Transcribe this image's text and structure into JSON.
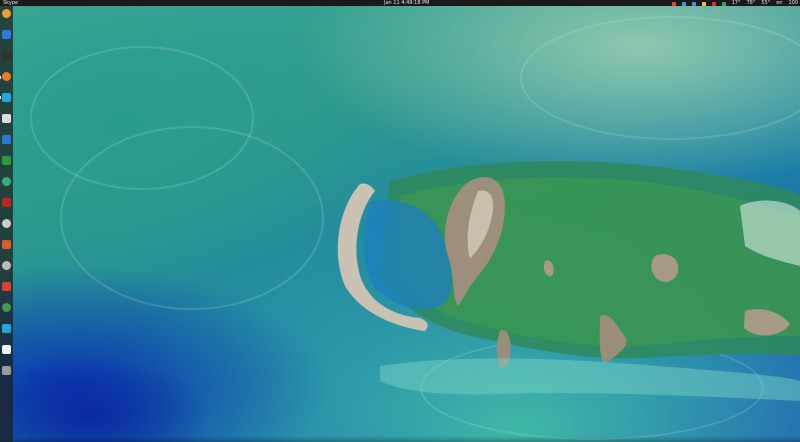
{
  "top_panel": {
    "app_name": "Skype",
    "clock": "Jan 11  4:49:18 PM",
    "tray": [
      {
        "name": "chrome-tray-icon",
        "color": "#e44d3a"
      },
      {
        "name": "skype-tray-icon",
        "color": "#2aa9e0"
      },
      {
        "name": "dropbox-tray-icon",
        "color": "#4a90e2"
      },
      {
        "name": "note-tray-icon",
        "color": "#f3c13a"
      },
      {
        "name": "red-app-tray-icon",
        "color": "#d9342b"
      },
      {
        "name": "green-app-tray-icon",
        "color": "#3caa4f"
      }
    ],
    "temp_1": "17°",
    "temp_2": "78°",
    "temp_3": "55°",
    "lang": "en",
    "battery": "100"
  },
  "dock": {
    "icons": [
      {
        "name": "files-icon",
        "color": "#f0a030"
      },
      {
        "name": "vscode-icon",
        "color": "#2b7bd8"
      },
      {
        "name": "terminal-icon",
        "color": "#333333"
      },
      {
        "name": "apps-icon",
        "color": "#555555"
      },
      {
        "name": "firefox-icon",
        "color": "#f07a1a"
      },
      {
        "name": "skype-icon",
        "color": "#1ea8e0"
      },
      {
        "name": "texteditor-icon",
        "color": "#dddddd"
      },
      {
        "name": "document-icon",
        "color": "#f5f5f5"
      },
      {
        "name": "dropbox-icon",
        "color": "#2a77d6"
      },
      {
        "name": "vim-icon",
        "color": "#2e9a3e"
      },
      {
        "name": "green-circle-icon",
        "color": "#33b07a"
      },
      {
        "name": "filezilla-icon",
        "color": "#c0261f"
      },
      {
        "name": "unity-icon",
        "color": "#cccccc"
      },
      {
        "name": "software-center-icon",
        "color": "#e05a2a"
      },
      {
        "name": "unity2-icon",
        "color": "#bbbbbb"
      },
      {
        "name": "red-app-icon",
        "color": "#e0402e"
      },
      {
        "name": "chrome-icon",
        "color": "#3c9e48"
      },
      {
        "name": "skype2-icon",
        "color": "#1ea8e0"
      },
      {
        "name": "writer-icon",
        "color": "#f2f2f2"
      },
      {
        "name": "trash-icon",
        "color": "#9a9a9a"
      }
    ]
  }
}
